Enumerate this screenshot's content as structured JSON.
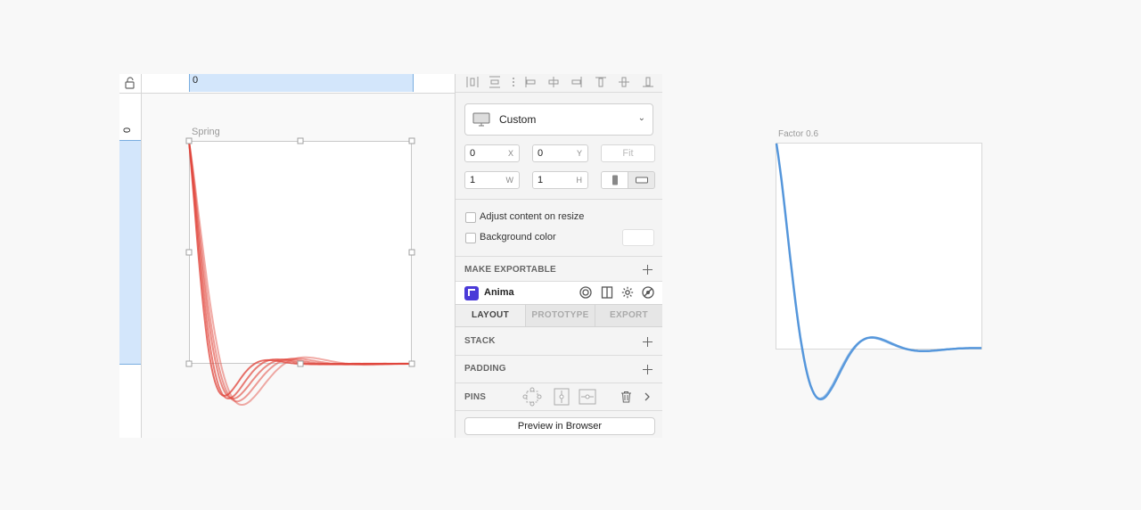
{
  "canvas": {
    "ruler_top_value": "0",
    "ruler_left_value": "0",
    "artboard_name": "Spring",
    "curve_color": "#e0443a"
  },
  "inspector": {
    "device": {
      "label": "Custom",
      "icon": "monitor-icon"
    },
    "position": {
      "x": "0",
      "x_unit": "X",
      "y": "0",
      "y_unit": "Y",
      "fit_label": "Fit"
    },
    "size": {
      "w": "1",
      "w_unit": "W",
      "h": "1",
      "h_unit": "H"
    },
    "options": {
      "adjust_content": "Adjust content on resize",
      "background_color": "Background color"
    },
    "make_exportable": "MAKE EXPORTABLE",
    "anima": {
      "name": "Anima",
      "brand_color": "#4a3ad8"
    },
    "tabs": [
      {
        "label": "LAYOUT",
        "active": true
      },
      {
        "label": "PROTOTYPE",
        "active": false
      },
      {
        "label": "EXPORT",
        "active": false
      }
    ],
    "sections": {
      "stack": "STACK",
      "padding": "PADDING",
      "pins": "PINS"
    },
    "preview_button": "Preview in Browser"
  },
  "factor_graph": {
    "label": "Factor 0.6",
    "curve_color": "#4a90d9"
  }
}
